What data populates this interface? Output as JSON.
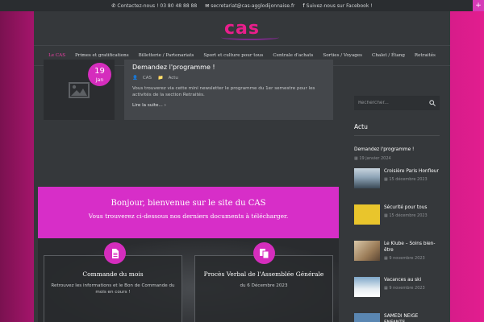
{
  "topbar": {
    "phone": "Contactez-nous ! 03 80 48 88 88",
    "email": "secretariat@cas-agglodijonnaise.fr",
    "facebook": "Suivez-nous sur Facebook !"
  },
  "corner_toggle": "+",
  "logo": "cas",
  "nav": [
    {
      "label": "Le CAS",
      "active": true
    },
    {
      "label": "Primes et gratifications"
    },
    {
      "label": "Billetterie / Partenariats"
    },
    {
      "label": "Sport et culture pour tous"
    },
    {
      "label": "Centrale d'achats"
    },
    {
      "label": "Sorties / Voyages"
    },
    {
      "label": "Chalet / Étang"
    },
    {
      "label": "Retraités"
    }
  ],
  "post": {
    "day": "19",
    "month": "Jan",
    "title": "Demandez l'programme !",
    "author": "CAS",
    "category": "Actu",
    "excerpt": "Vous trouverez via cette mini newsletter le programme du 1er semestre pour les activités de la section Retraités.",
    "read_more": "Lire la suite... ›"
  },
  "welcome": {
    "title": "Bonjour, bienvenue sur le site du CAS",
    "subtitle": "Vous trouverez ci-dessous nos derniers documents à télécharger."
  },
  "cards": [
    {
      "title": "Commande du mois",
      "desc": "Retrouvez les informations et le Bon de Commande du mois en cours !"
    },
    {
      "title": "Procès Verbal de l'Assemblée Générale",
      "desc": "du 6 Décembre 2023"
    }
  ],
  "sidebar": {
    "search_placeholder": "Rechercher...",
    "section_title": "Actu",
    "featured": {
      "title": "Demandez l'programme !",
      "date": "19 janvier 2024"
    },
    "items": [
      {
        "title": "Croisière Paris Honfleur",
        "date": "15 décembre 2023"
      },
      {
        "title": "Sécurité pour tous",
        "date": "15 décembre 2023"
      },
      {
        "title": "Le Klube – Soins bien-être",
        "date": "9 novembre 2023"
      },
      {
        "title": "Vacances au ski",
        "date": "9 novembre 2023"
      },
      {
        "title": "SAMEDI NEIGE ENFANTS",
        "date": ""
      }
    ]
  },
  "colors": {
    "accent": "#d52dbd",
    "nav_active": "#ef3fa6",
    "page_bg": "#35383b"
  }
}
